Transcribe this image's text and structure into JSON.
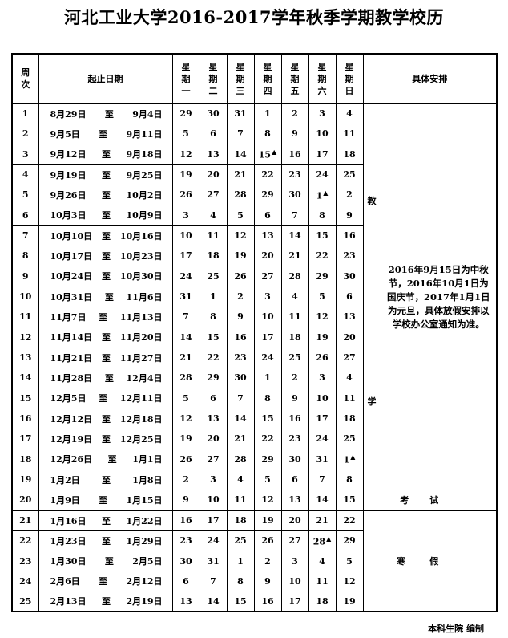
{
  "title": "河北工业大学2016-2017学年秋季学期教学校历",
  "headers": {
    "week": [
      "周",
      "次"
    ],
    "range": "起止日期",
    "days": [
      [
        "星",
        "期",
        "一"
      ],
      [
        "星",
        "期",
        "二"
      ],
      [
        "星",
        "期",
        "三"
      ],
      [
        "星",
        "期",
        "四"
      ],
      [
        "星",
        "期",
        "五"
      ],
      [
        "星",
        "期",
        "六"
      ],
      [
        "星",
        "期",
        "日"
      ]
    ],
    "schedule": "具体安排"
  },
  "range_sep": "至",
  "marker": "▲",
  "rows": [
    {
      "w": "1",
      "s": "8月29日",
      "e": "9月4日",
      "d": [
        "29",
        "30",
        "31",
        "1",
        "2",
        "3",
        "4"
      ]
    },
    {
      "w": "2",
      "s": "9月5日",
      "e": "9月11日",
      "d": [
        "5",
        "6",
        "7",
        "8",
        "9",
        "10",
        "11"
      ]
    },
    {
      "w": "3",
      "s": "9月12日",
      "e": "9月18日",
      "d": [
        "12",
        "13",
        "14",
        "15",
        "16",
        "17",
        "18"
      ],
      "mark": 3
    },
    {
      "w": "4",
      "s": "9月19日",
      "e": "9月25日",
      "d": [
        "19",
        "20",
        "21",
        "22",
        "23",
        "24",
        "25"
      ]
    },
    {
      "w": "5",
      "s": "9月26日",
      "e": "10月2日",
      "d": [
        "26",
        "27",
        "28",
        "29",
        "30",
        "1",
        "2"
      ],
      "mark": 5
    },
    {
      "w": "6",
      "s": "10月3日",
      "e": "10月9日",
      "d": [
        "3",
        "4",
        "5",
        "6",
        "7",
        "8",
        "9"
      ]
    },
    {
      "w": "7",
      "s": "10月10日",
      "e": "10月16日",
      "d": [
        "10",
        "11",
        "12",
        "13",
        "14",
        "15",
        "16"
      ]
    },
    {
      "w": "8",
      "s": "10月17日",
      "e": "10月23日",
      "d": [
        "17",
        "18",
        "19",
        "20",
        "21",
        "22",
        "23"
      ]
    },
    {
      "w": "9",
      "s": "10月24日",
      "e": "10月30日",
      "d": [
        "24",
        "25",
        "26",
        "27",
        "28",
        "29",
        "30"
      ]
    },
    {
      "w": "10",
      "s": "10月31日",
      "e": "11月6日",
      "d": [
        "31",
        "1",
        "2",
        "3",
        "4",
        "5",
        "6"
      ]
    },
    {
      "w": "11",
      "s": "11月7日",
      "e": "11月13日",
      "d": [
        "7",
        "8",
        "9",
        "10",
        "11",
        "12",
        "13"
      ]
    },
    {
      "w": "12",
      "s": "11月14日",
      "e": "11月20日",
      "d": [
        "14",
        "15",
        "16",
        "17",
        "18",
        "19",
        "20"
      ]
    },
    {
      "w": "13",
      "s": "11月21日",
      "e": "11月27日",
      "d": [
        "21",
        "22",
        "23",
        "24",
        "25",
        "26",
        "27"
      ]
    },
    {
      "w": "14",
      "s": "11月28日",
      "e": "12月4日",
      "d": [
        "28",
        "29",
        "30",
        "1",
        "2",
        "3",
        "4"
      ]
    },
    {
      "w": "15",
      "s": "12月5日",
      "e": "12月11日",
      "d": [
        "5",
        "6",
        "7",
        "8",
        "9",
        "10",
        "11"
      ]
    },
    {
      "w": "16",
      "s": "12月12日",
      "e": "12月18日",
      "d": [
        "12",
        "13",
        "14",
        "15",
        "16",
        "17",
        "18"
      ]
    },
    {
      "w": "17",
      "s": "12月19日",
      "e": "12月25日",
      "d": [
        "19",
        "20",
        "21",
        "22",
        "23",
        "24",
        "25"
      ]
    },
    {
      "w": "18",
      "s": "12月26日",
      "e": "1月1日",
      "d": [
        "26",
        "27",
        "28",
        "29",
        "30",
        "31",
        "1"
      ],
      "mark": 6
    },
    {
      "w": "19",
      "s": "1月2日",
      "e": "1月8日",
      "d": [
        "2",
        "3",
        "4",
        "5",
        "6",
        "7",
        "8"
      ]
    },
    {
      "w": "20",
      "s": "1月9日",
      "e": "1月15日",
      "d": [
        "9",
        "10",
        "11",
        "12",
        "13",
        "14",
        "15"
      ]
    },
    {
      "w": "21",
      "s": "1月16日",
      "e": "1月22日",
      "d": [
        "16",
        "17",
        "18",
        "19",
        "20",
        "21",
        "22"
      ]
    },
    {
      "w": "22",
      "s": "1月23日",
      "e": "1月29日",
      "d": [
        "23",
        "24",
        "25",
        "26",
        "27",
        "28",
        "29"
      ],
      "mark": 5
    },
    {
      "w": "23",
      "s": "1月30日",
      "e": "2月5日",
      "d": [
        "30",
        "31",
        "1",
        "2",
        "3",
        "4",
        "5"
      ]
    },
    {
      "w": "24",
      "s": "2月6日",
      "e": "2月12日",
      "d": [
        "6",
        "7",
        "8",
        "9",
        "10",
        "11",
        "12"
      ]
    },
    {
      "w": "25",
      "s": "2月13日",
      "e": "2月19日",
      "d": [
        "13",
        "14",
        "15",
        "16",
        "17",
        "18",
        "19"
      ]
    }
  ],
  "teaching": [
    "教",
    "学"
  ],
  "note": "2016年9月15日为中秋节，2016年10月1日为国庆节，2017年1月1日为元旦，具体放假安排以学校办公室通知为准。",
  "exam": "考试",
  "vacation": "寒假",
  "footer": "本科生院 编制"
}
